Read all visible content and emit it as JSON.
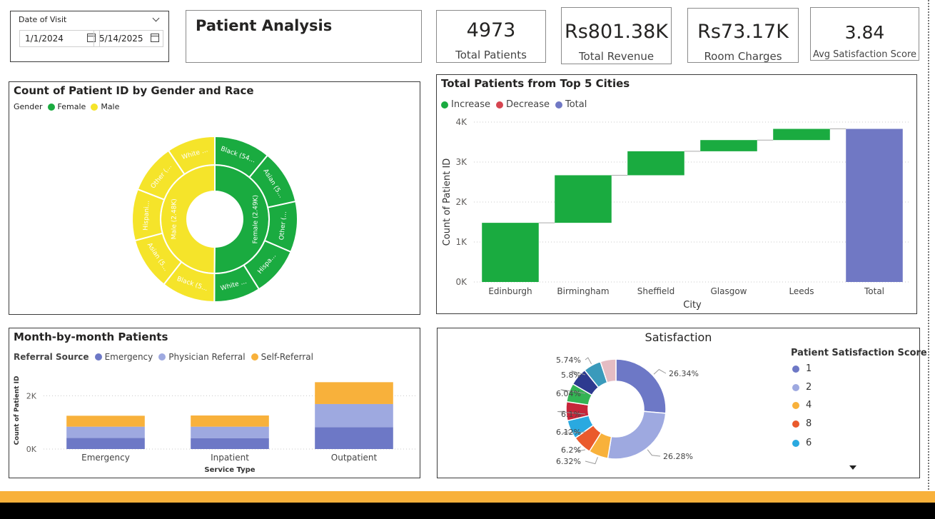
{
  "filter": {
    "label": "Date of Visit",
    "start": "1/1/2024",
    "end": "5/14/2025"
  },
  "page_title": "Patient Analysis",
  "kpis": [
    {
      "value": "4973",
      "label": "Total Patients"
    },
    {
      "value": "Rs801.38K",
      "label": "Total Revenue"
    },
    {
      "value": "Rs73.17K",
      "label": "Room Charges"
    },
    {
      "value": "3.84",
      "label": "Avg Satisfaction Score"
    }
  ],
  "colors": {
    "female": "#1aab40",
    "male": "#f5e42a",
    "increase": "#1aab40",
    "decrease": "#d64550",
    "total": "#7078c4",
    "emergency": "#6d78c6",
    "physician": "#9ea9e0",
    "self": "#f8b13b",
    "accent_bar": "#f8b13b",
    "footer": "#000000"
  },
  "chart_data": [
    {
      "type": "sunburst",
      "title": "Count of Patient ID by Gender and Race",
      "legend_title": "Gender",
      "legend": [
        "Female",
        "Male"
      ],
      "inner_labels": [
        "Female (2.49K)",
        "Male (2.48K)"
      ],
      "inner_values": [
        2490,
        2480
      ],
      "outer": [
        {
          "parent": "Female",
          "label": "Black (54...",
          "value": 546
        },
        {
          "parent": "Female",
          "label": "Asian (5...",
          "value": 525
        },
        {
          "parent": "Female",
          "label": "Other (...",
          "value": 493
        },
        {
          "parent": "Female",
          "label": "Hispa...",
          "value": 476
        },
        {
          "parent": "Female",
          "label": "White ...",
          "value": 450
        },
        {
          "parent": "Male",
          "label": "Black (5...",
          "value": 520
        },
        {
          "parent": "Male",
          "label": "Asian (5...",
          "value": 510
        },
        {
          "parent": "Male",
          "label": "Hispani...",
          "value": 500
        },
        {
          "parent": "Male",
          "label": "Other (...",
          "value": 480
        },
        {
          "parent": "Male",
          "label": "White ...",
          "value": 470
        }
      ]
    },
    {
      "type": "waterfall",
      "title": "Total Patients from Top 5 Cities",
      "legend": [
        "Increase",
        "Decrease",
        "Total"
      ],
      "categories": [
        "Edinburgh",
        "Birmingham",
        "Sheffield",
        "Glasgow",
        "Leeds",
        "Total"
      ],
      "values": [
        1480,
        1190,
        600,
        280,
        280,
        3830
      ],
      "xlabel": "City",
      "ylabel": "Count of Patient ID",
      "yticks": [
        "0K",
        "1K",
        "2K",
        "3K",
        "4K"
      ],
      "ylim": [
        0,
        4000
      ]
    },
    {
      "type": "bar",
      "stacked": true,
      "title": "Month-by-month Patients",
      "legend_title": "Referral Source",
      "categories": [
        "Emergency",
        "Inpatient",
        "Outpatient"
      ],
      "series": [
        {
          "name": "Emergency",
          "values": [
            420,
            410,
            820
          ]
        },
        {
          "name": "Physician Referral",
          "values": [
            420,
            430,
            870
          ]
        },
        {
          "name": "Self-Referral",
          "values": [
            410,
            420,
            820
          ]
        }
      ],
      "xlabel": "Service Type",
      "ylabel": "Count of Patient ID",
      "yticks": [
        "0K",
        "2K"
      ],
      "ylim": [
        0,
        2600
      ]
    },
    {
      "type": "pie",
      "donut": true,
      "title": "Satisfaction",
      "legend_title": "Patient Satisfaction Score",
      "slices": [
        {
          "name": "1",
          "value": 26.34,
          "label": "26.34%",
          "color": "#6d78c6"
        },
        {
          "name": "2",
          "value": 26.28,
          "label": "26.28%",
          "color": "#9ea9e0"
        },
        {
          "name": "4",
          "value": 6.32,
          "label": "6.32%",
          "color": "#f8b13b"
        },
        {
          "name": "8",
          "value": 6.2,
          "label": "6.2%",
          "color": "#ea5a2c"
        },
        {
          "name": "6",
          "value": 6.12,
          "label": "6.12%",
          "color": "#2aa9e0"
        },
        {
          "name": "",
          "value": 6.1,
          "label": "6.1%",
          "color": "#c6263a"
        },
        {
          "name": "",
          "value": 6.04,
          "label": "6.04%",
          "color": "#33b454"
        },
        {
          "name": "",
          "value": 5.8,
          "label": "5.8%",
          "color": "#2d3a8f"
        },
        {
          "name": "",
          "value": 5.74,
          "label": "5.74%",
          "color": "#3a9abb"
        },
        {
          "name": "",
          "value": 5.06,
          "label": "",
          "color": "#e4bcc3"
        }
      ]
    }
  ]
}
